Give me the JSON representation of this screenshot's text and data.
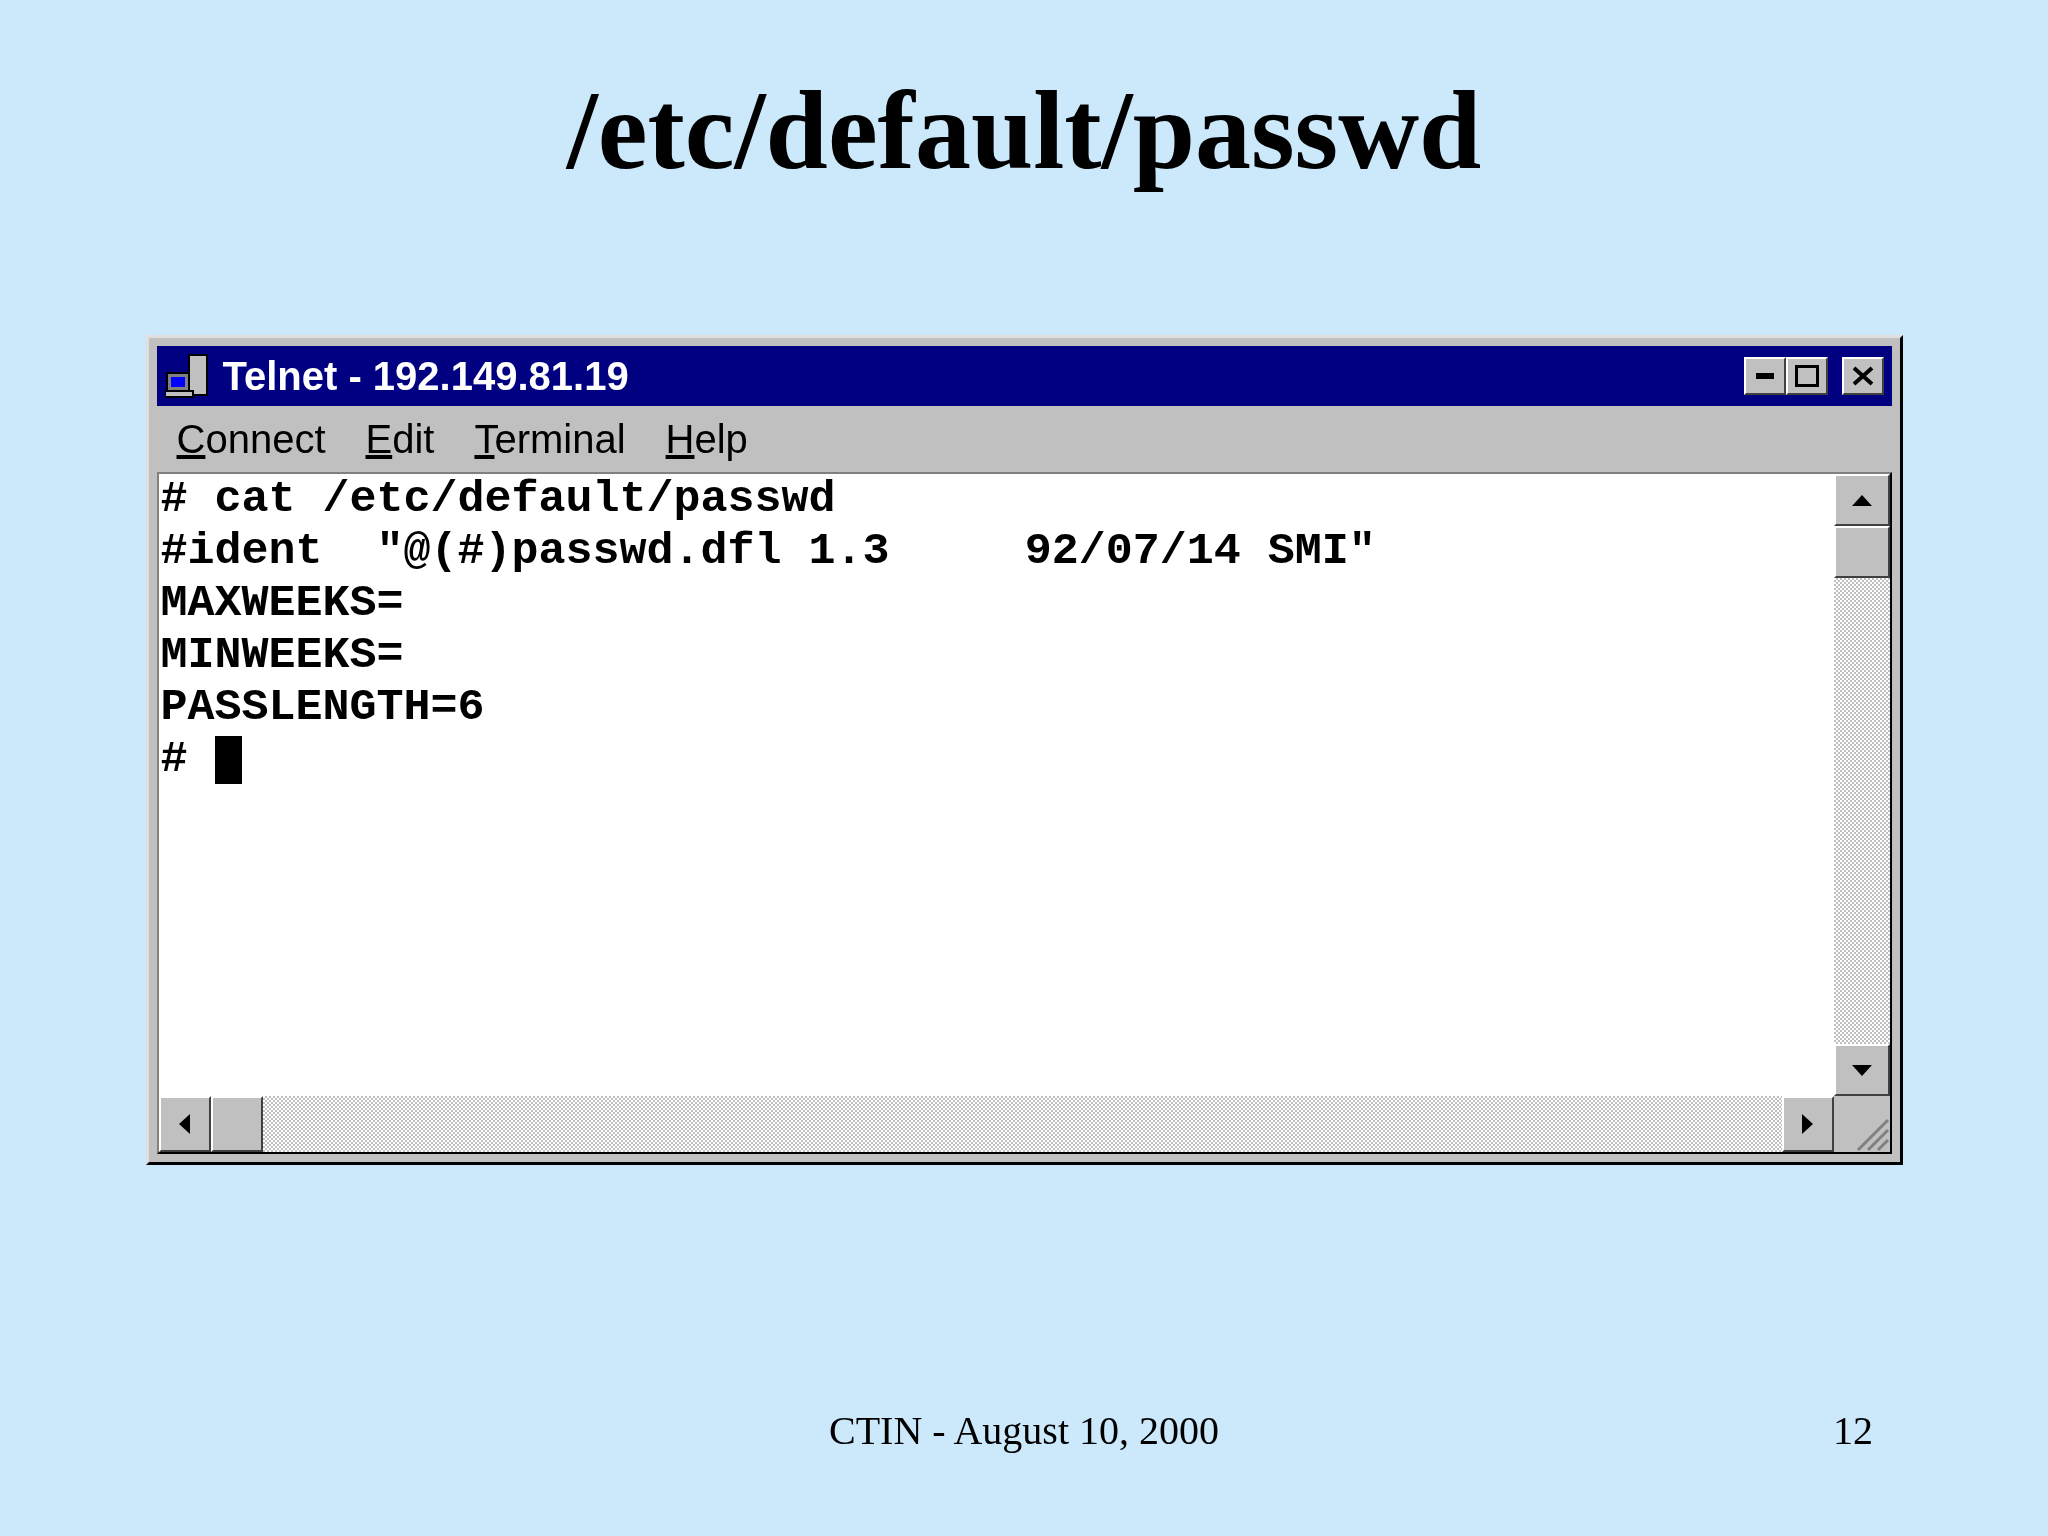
{
  "slide": {
    "title": "/etc/default/passwd",
    "footer": "CTIN - August 10, 2000",
    "page_number": "12"
  },
  "window": {
    "title": "Telnet - 192.149.81.19",
    "menu": [
      "Connect",
      "Edit",
      "Terminal",
      "Help"
    ],
    "terminal": {
      "lines": [
        "# cat /etc/default/passwd",
        "#ident  \"@(#)passwd.dfl 1.3     92/07/14 SMI\"",
        "MAXWEEKS=",
        "MINWEEKS=",
        "PASSLENGTH=6"
      ],
      "prompt": "#",
      "cursor": true
    }
  }
}
